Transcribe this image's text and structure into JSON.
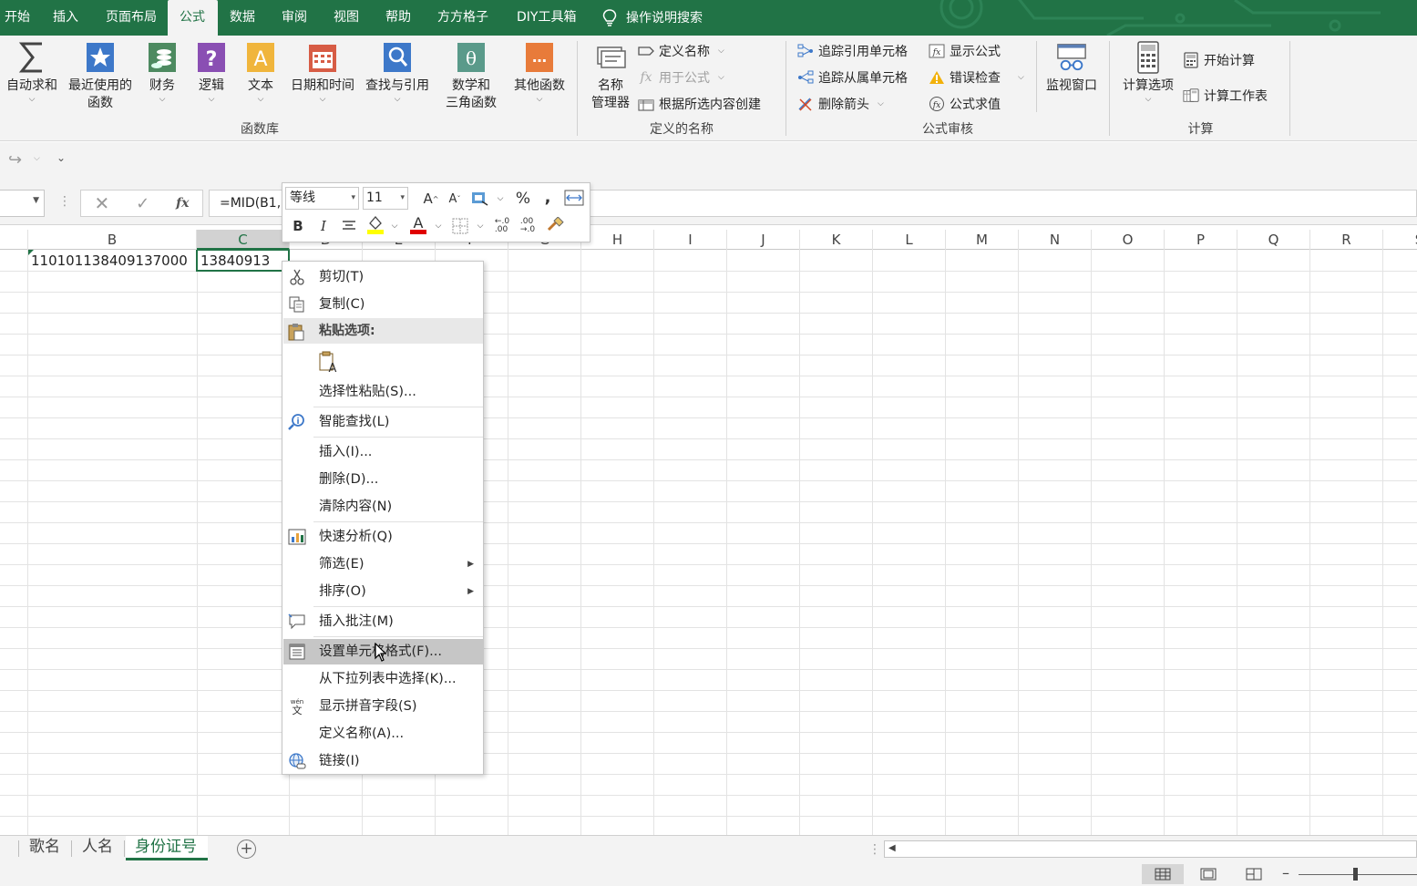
{
  "tabs": [
    "开始",
    "插入",
    "页面布局",
    "公式",
    "数据",
    "审阅",
    "视图",
    "帮助",
    "方方格子",
    "DIY工具箱",
    "操作说明搜索"
  ],
  "active_tab": "公式",
  "ribbon": {
    "function_library": {
      "label": "函数库",
      "buttons": [
        "自动求和",
        "最近使用的\n函数",
        "财务",
        "逻辑",
        "文本",
        "日期和时间",
        "查找与引用",
        "数学和\n三角函数",
        "其他函数"
      ]
    },
    "defined_names": {
      "label": "定义的名称",
      "name_manager": "名称\n管理器",
      "define_name": "定义名称",
      "use_in_formula": "用于公式",
      "create_from_selection": "根据所选内容创建"
    },
    "formula_auditing": {
      "label": "公式审核",
      "trace_precedents": "追踪引用单元格",
      "trace_dependents": "追踪从属单元格",
      "remove_arrows": "删除箭头",
      "show_formulas": "显示公式",
      "error_checking": "错误检查",
      "evaluate_formula": "公式求值",
      "watch_window": "监视窗口"
    },
    "calculation": {
      "label": "计算",
      "calc_options": "计算选项",
      "calc_now": "开始计算",
      "calc_sheet": "计算工作表"
    }
  },
  "formula_bar": {
    "formula": "=MID(B1,"
  },
  "columns": [
    "B",
    "C",
    "D",
    "E",
    "F",
    "G",
    "H",
    "I",
    "J",
    "K",
    "L",
    "M",
    "N",
    "O",
    "P",
    "Q",
    "R",
    "S"
  ],
  "selected_column": "C",
  "cells": {
    "B1": "110101138409137000",
    "C1": "13840913"
  },
  "mini_toolbar": {
    "font_name": "等线",
    "font_size": "11"
  },
  "context_menu": {
    "cut": "剪切(T)",
    "copy": "复制(C)",
    "paste_options": "粘贴选项:",
    "paste_special": "选择性粘贴(S)...",
    "smart_lookup": "智能查找(L)",
    "insert": "插入(I)...",
    "delete": "删除(D)...",
    "clear_contents": "清除内容(N)",
    "quick_analysis": "快速分析(Q)",
    "filter": "筛选(E)",
    "sort": "排序(O)",
    "insert_comment": "插入批注(M)",
    "format_cells": "设置单元格格式(F)...",
    "pick_from_list": "从下拉列表中选择(K)...",
    "show_phonetic": "显示拼音字段(S)",
    "define_name": "定义名称(A)...",
    "link": "链接(I)"
  },
  "highlighted_menu_item": "设置单元格格式(F)...",
  "sheets": [
    "歌名",
    "人名",
    "身份证号"
  ],
  "active_sheet": "身份证号",
  "colors": {
    "accent": "#217346",
    "ribbon_bg": "#f3f3f3",
    "menu_highlight": "#c6c6c6"
  },
  "icons": [
    "lightbulb-icon",
    "sigma-icon",
    "star-icon",
    "finance-icon",
    "logic-icon",
    "text-icon",
    "calendar-icon",
    "lookup-icon",
    "theta-icon",
    "more-functions-icon",
    "name-manager-icon",
    "tag-icon",
    "fx-icon",
    "create-names-icon",
    "trace-precedents-icon",
    "trace-dependents-icon",
    "remove-arrows-icon",
    "show-formulas-icon",
    "error-check-icon",
    "evaluate-icon",
    "watch-window-icon",
    "calc-options-icon",
    "calc-now-icon",
    "calc-sheet-icon",
    "scissors-icon",
    "copy-icon",
    "paste-icon",
    "smart-lookup-icon",
    "quick-analysis-icon",
    "comment-icon",
    "format-cells-icon",
    "phonetic-icon",
    "link-icon"
  ]
}
